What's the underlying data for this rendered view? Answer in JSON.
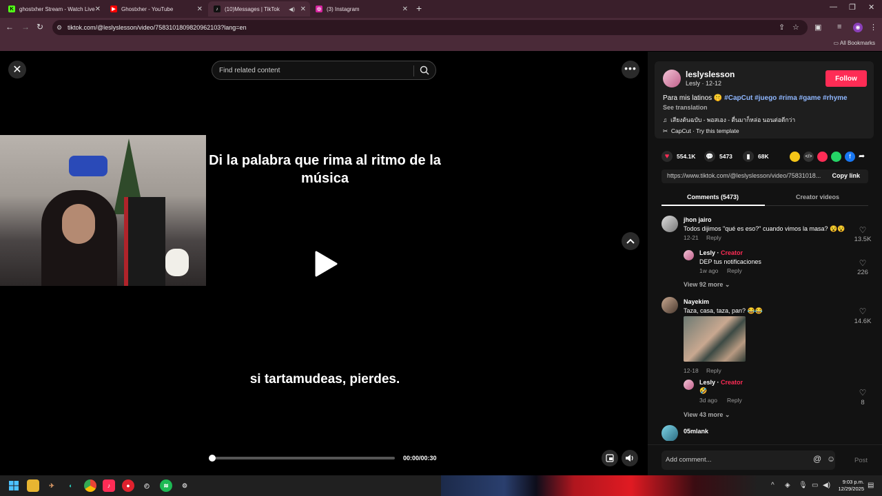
{
  "browser": {
    "tabs": [
      {
        "title": "ghostxher Stream - Watch Live",
        "icon": "kick-icon",
        "color": "#53fc18"
      },
      {
        "title": "Ghostxher - YouTube",
        "icon": "youtube-icon",
        "color": "#ff0000"
      },
      {
        "title": "(10)Messages | TikTok",
        "icon": "tiktok-icon",
        "color": "#000000"
      },
      {
        "title": "(3) Instagram",
        "icon": "instagram-icon",
        "color": "#d6249f"
      }
    ],
    "url": "tiktok.com/@leslyslesson/video/7583101809820962103?lang=en",
    "all_bookmarks": "All Bookmarks"
  },
  "page": {
    "search_placeholder": "Find related content",
    "caption_top": "Di la palabra que rima al ritmo de la música",
    "caption_bottom": "si tartamudeas, pierdes.",
    "timecode": "00:00/00:30",
    "progress": 0.0
  },
  "panel": {
    "username": "leslyslesson",
    "meta": "Lesly · 12-12",
    "follow": "Follow",
    "desc_text": "Para mis latinos 🤫",
    "hashtags": [
      "#CapCut",
      "#juego",
      "#rima",
      "#game",
      "#rhyme"
    ],
    "see_translation": "See translation",
    "music": "เสียงต้นฉบับ - พอสเอง - ตื่นมาก็หล่อ นอนต่อดีกว่า",
    "capcut": "CapCut · Try this template",
    "likes": "554.1K",
    "comments_count": "5473",
    "saves": "68K",
    "link": "https://www.tiktok.com/@leslyslesson/video/75831018...",
    "copy_link": "Copy link",
    "tab_comments": "Comments (5473)",
    "tab_creator": "Creator videos"
  },
  "comments": [
    {
      "name": "jhon jairo",
      "text": "Todos dijimos \"qué es eso?\" cuando vimos la masa? 😵😵",
      "date": "12-21",
      "reply": "Reply",
      "likes": "13.5K",
      "sub": {
        "name": "Lesly",
        "badge": "Creator",
        "text": "DEP tus notificaciones",
        "date": "1w ago",
        "reply": "Reply",
        "likes": "226"
      },
      "view_more": "View 92 more"
    },
    {
      "name": "Nayekim",
      "text": "Taza, casa, taza, pan? 😂😂",
      "date": "12-18",
      "reply": "Reply",
      "likes": "14.6K",
      "sub": {
        "name": "Lesly",
        "badge": "Creator",
        "text": "🤣",
        "date": "3d ago",
        "reply": "Reply",
        "likes": "8"
      },
      "view_more": "View 43 more"
    },
    {
      "name": "05mlank"
    }
  ],
  "add_comment": {
    "placeholder": "Add comment...",
    "post": "Post"
  },
  "taskbar": {
    "time": "9:03 p.m.",
    "date": "12/29/2025"
  }
}
